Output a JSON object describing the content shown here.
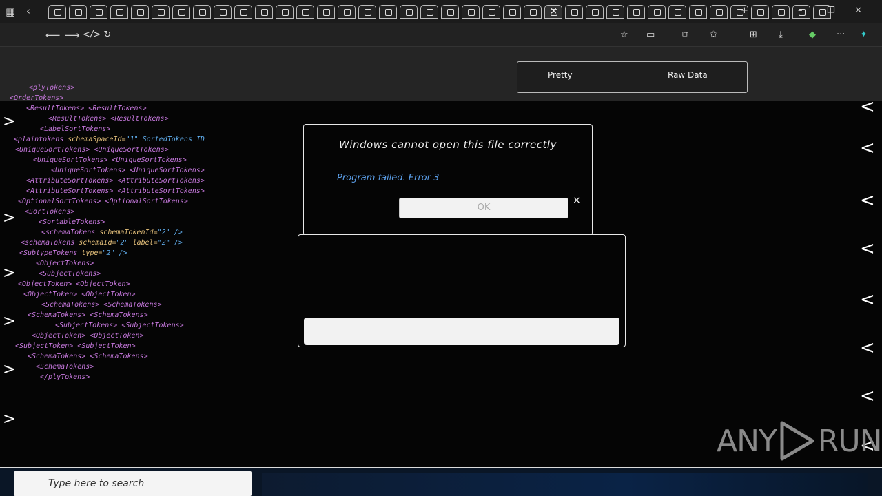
{
  "browser": {
    "tab_count": 38,
    "active_tab_close": "×",
    "new_tab": "+",
    "window_minimize": "–",
    "window_restore": "❐",
    "window_close": "✕"
  },
  "toolbar": {
    "back_icon": "back-arrow-icon",
    "forward_icon": "forward-arrow-icon",
    "reload": "↻",
    "address": "&lt;&gt;"
  },
  "popup": {
    "left_item": "Pretty",
    "right_item": "Raw Data"
  },
  "xml_lines": [
    "<plyTokens>",
    "<OrderTokens>",
    "<ResultTokens>   <ResultTokens>",
    "<ResultTokens>   <ResultTokens>",
    "<LabelSortTokens>",
    "<plaintokens schemaSpaceId=\"1\" SortedTokens ID",
    "<UniqueSortTokens>   <UniqueSortTokens>",
    "<UniqueSortTokens>   <UniqueSortTokens>",
    "<UniqueSortTokens>   <UniqueSortTokens>",
    "<AttributeSortTokens>   <AttributeSortTokens>",
    "<AttributeSortTokens>   <AttributeSortTokens>",
    "<OptionalSortTokens>   <OptionalSortTokens>",
    "<SortTokens>",
    "<SortableTokens>",
    "<schemaTokens schemaTokenId=\"2\" />",
    "<schemaTokens schemaId=\"2\" label=\"2\" />",
    "<SubtypeTokens type=\"2\" />",
    "<ObjectTokens>",
    "<SubjectTokens>",
    "<ObjectToken>   <ObjectToken>",
    "<ObjectToken>   <ObjectToken>",
    "<SchemaTokens>   <SchemaTokens>",
    "<SchemaTokens>   <SchemaTokens>",
    "<SubjectTokens>   <SubjectTokens>",
    "<ObjectToken>   <ObjectToken>",
    "<SubjectToken>   <SubjectToken>",
    "<SchemaTokens>   <SchemaTokens>",
    "<SchemaTokens>",
    "</plyTokens>"
  ],
  "dialog": {
    "title": "Windows cannot open this file correctly",
    "message": "Program failed. Error 3",
    "ok_label": "OK",
    "close": "×"
  },
  "watermark": {
    "left": "ANY",
    "right": "RUN"
  },
  "taskbar": {
    "search_text": "Type here to search"
  }
}
